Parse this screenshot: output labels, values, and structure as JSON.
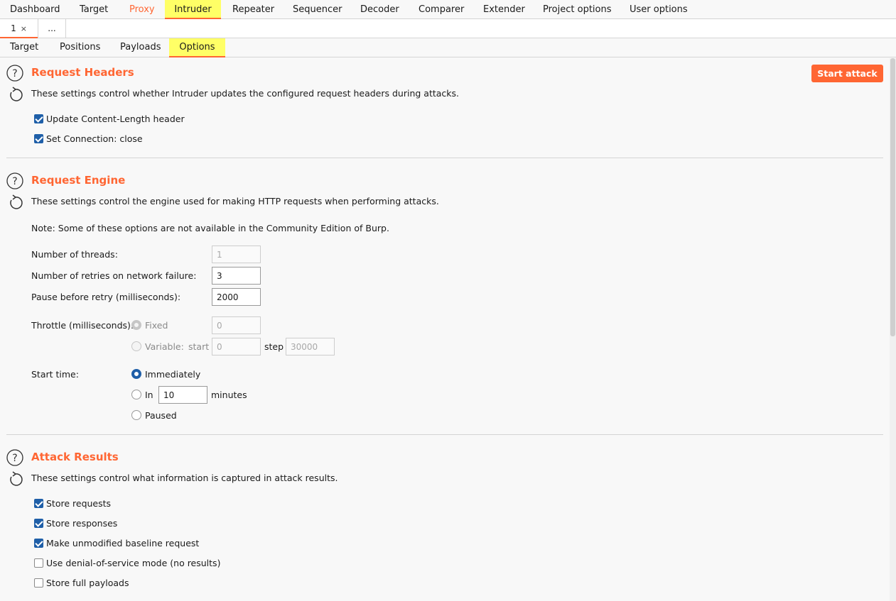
{
  "top_tabs": [
    "Dashboard",
    "Target",
    "Proxy",
    "Intruder",
    "Repeater",
    "Sequencer",
    "Decoder",
    "Comparer",
    "Extender",
    "Project options",
    "User options"
  ],
  "active_top_tab": "Intruder",
  "attack_tabs": {
    "current": "1",
    "close_symbol": "×",
    "more": "..."
  },
  "option_tabs": [
    "Target",
    "Positions",
    "Payloads",
    "Options"
  ],
  "active_option_tab": "Options",
  "start_attack": "Start attack",
  "request_headers": {
    "title": "Request Headers",
    "description": "These settings control whether Intruder updates the configured request headers during attacks.",
    "options": [
      {
        "label": "Update Content-Length header",
        "checked": true
      },
      {
        "label": "Set Connection: close",
        "checked": true
      }
    ]
  },
  "request_engine": {
    "title": "Request Engine",
    "description": "These settings control the engine used for making HTTP requests when performing attacks.",
    "note": "Note: Some of these options are not available in the Community Edition of Burp.",
    "threads_label": "Number of threads:",
    "threads_value": "1",
    "retries_label": "Number of retries on network failure:",
    "retries_value": "3",
    "pause_label": "Pause before retry (milliseconds):",
    "pause_value": "2000",
    "throttle_label": "Throttle (milliseconds):",
    "throttle_fixed_label": "Fixed",
    "throttle_fixed_value": "0",
    "throttle_variable_label": "Variable:",
    "throttle_start_label": "start",
    "throttle_start_value": "0",
    "throttle_step_label": "step",
    "throttle_step_value": "30000",
    "start_time_label": "Start time:",
    "start_immediately": "Immediately",
    "start_in": "In",
    "start_in_value": "10",
    "start_minutes": "minutes",
    "start_paused": "Paused"
  },
  "attack_results": {
    "title": "Attack Results",
    "description": "These settings control what information is captured in attack results.",
    "options": [
      {
        "label": "Store requests",
        "checked": true
      },
      {
        "label": "Store responses",
        "checked": true
      },
      {
        "label": "Make unmodified baseline request",
        "checked": true
      },
      {
        "label": "Use denial-of-service mode (no results)",
        "checked": false
      },
      {
        "label": "Store full payloads",
        "checked": false
      }
    ]
  },
  "colors": {
    "accent": "#ff6633",
    "highlight": "#ffff66",
    "check": "#1f5fa8"
  }
}
